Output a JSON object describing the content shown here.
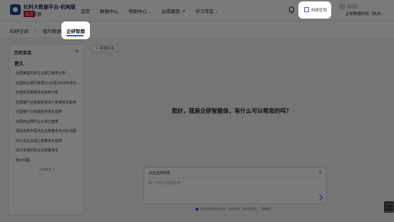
{
  "brand": {
    "title": "社科大数据平台-机构版",
    "badge": "北京",
    "badge_suffix": "数据"
  },
  "nav": {
    "items": [
      {
        "label": "首页",
        "has_dropdown": false
      },
      {
        "label": "数据中心",
        "has_dropdown": false
      },
      {
        "label": "帮助中心",
        "has_dropdown": true
      },
      {
        "label": "云成题目 ↗",
        "has_dropdown": false
      },
      {
        "label": "学习专区",
        "has_dropdown": true
      }
    ]
  },
  "header": {
    "space_button": "科研空间",
    "user_name": "企研数据科技（杭州..."
  },
  "tabs": [
    {
      "label": "科研空间"
    },
    {
      "label": "我的数据"
    },
    {
      "label": "企研智图"
    }
  ],
  "sidebar": {
    "title": "历史会话",
    "group": "更久",
    "items": [
      "全国家庭的体生业成立趋势分析",
      "全国商业银行数据2016至2024年变化...",
      "全国机构数据变化趋势分析",
      "全国银行业金融机构法人数量变化趋势",
      "全国银行业金融机构变化趋势",
      "全国商业网件业企成立趋势",
      "福建省数字经济企业数量变化对比线图",
      "浙江省企业成立数量变化趋势",
      "浙江省高科技企业数量变化",
      "杭州线图"
    ],
    "end_text": "没有更多了"
  },
  "main": {
    "new_chat": "+ 新建会话",
    "greeting": "您好，我是企研智能体，有什么可以帮您的吗？",
    "input": {
      "select_label": "点击选择数据",
      "placeholder": "输入你的问题或需求"
    },
    "disclaimer": "该内容由智能体生成，仅供参考，请注意甄别。了解数据"
  },
  "colors": {
    "accent": "#2f54eb",
    "brand_red": "#c8102e",
    "overlay": "rgba(0,0,0,0.52)"
  }
}
